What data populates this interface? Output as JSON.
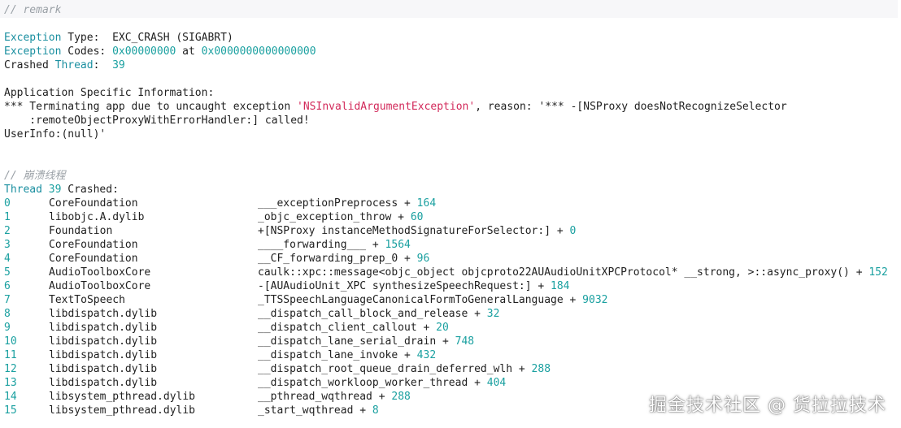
{
  "remark_comment": "// remark",
  "exception_type": {
    "key": "Exception",
    "label": " Type:  ",
    "value": "EXC_CRASH (SIGABRT)"
  },
  "exception_codes": {
    "key": "Exception",
    "label": " Codes: ",
    "code1": "0x00000000",
    "at": " at ",
    "code2": "0x0000000000000000"
  },
  "crashed_thread": {
    "prefix": "Crashed ",
    "key": "Thread",
    "label": ":  ",
    "value": "39"
  },
  "app_info_heading": "Application Specific Information:",
  "app_info_line1_pre": "*** Terminating app due to uncaught exception ",
  "app_info_line1_str": "'NSInvalidArgumentException'",
  "app_info_line1_post": ", reason: '*** -[NSProxy doesNotRecognizeSelector",
  "app_info_line2": "    :remoteObjectProxyWithErrorHandler:] called!",
  "app_info_line3": "UserInfo:(null)'",
  "crash_thread_comment": "// 崩溃线程",
  "thread_header": {
    "key": "Thread",
    "num": " 39",
    "label": " Crashed:"
  },
  "frames": [
    {
      "index": "0",
      "library": "CoreFoundation",
      "symbol": "___exceptionPreprocess + ",
      "offset": "164"
    },
    {
      "index": "1",
      "library": "libobjc.A.dylib",
      "symbol": "_objc_exception_throw + ",
      "offset": "60"
    },
    {
      "index": "2",
      "library": "Foundation",
      "symbol": "+[NSProxy instanceMethodSignatureForSelector:] + ",
      "offset": "0"
    },
    {
      "index": "3",
      "library": "CoreFoundation",
      "symbol": "____forwarding___ + ",
      "offset": "1564"
    },
    {
      "index": "4",
      "library": "CoreFoundation",
      "symbol": "__CF_forwarding_prep_0 + ",
      "offset": "96"
    },
    {
      "index": "5",
      "library": "AudioToolboxCore",
      "symbol": "caulk::xpc::message<objc_object objcproto22AUAudioUnitXPCProtocol* __strong, >::async_proxy() + ",
      "offset": "152"
    },
    {
      "index": "6",
      "library": "AudioToolboxCore",
      "symbol": "-[AUAudioUnit_XPC synthesizeSpeechRequest:] + ",
      "offset": "184"
    },
    {
      "index": "7",
      "library": "TextToSpeech",
      "symbol": "_TTSSpeechLanguageCanonicalFormToGeneralLanguage + ",
      "offset": "9032"
    },
    {
      "index": "8",
      "library": "libdispatch.dylib",
      "symbol": "__dispatch_call_block_and_release + ",
      "offset": "32"
    },
    {
      "index": "9",
      "library": "libdispatch.dylib",
      "symbol": "__dispatch_client_callout + ",
      "offset": "20"
    },
    {
      "index": "10",
      "library": "libdispatch.dylib",
      "symbol": "__dispatch_lane_serial_drain + ",
      "offset": "748"
    },
    {
      "index": "11",
      "library": "libdispatch.dylib",
      "symbol": "__dispatch_lane_invoke + ",
      "offset": "432"
    },
    {
      "index": "12",
      "library": "libdispatch.dylib",
      "symbol": "__dispatch_root_queue_drain_deferred_wlh + ",
      "offset": "288"
    },
    {
      "index": "13",
      "library": "libdispatch.dylib",
      "symbol": "__dispatch_workloop_worker_thread + ",
      "offset": "404"
    },
    {
      "index": "14",
      "library": "libsystem_pthread.dylib",
      "symbol": "__pthread_wqthread + ",
      "offset": "288"
    },
    {
      "index": "15",
      "library": "libsystem_pthread.dylib",
      "symbol": "_start_wqthread + ",
      "offset": "8"
    }
  ],
  "watermark": "掘金技术社区 @ 货拉拉技术",
  "colors": {
    "keyword": "#1a8fa0",
    "number": "#1aa0a0",
    "string": "#d2295a",
    "comment": "#9aa0a6",
    "text": "#1f1f1f"
  }
}
